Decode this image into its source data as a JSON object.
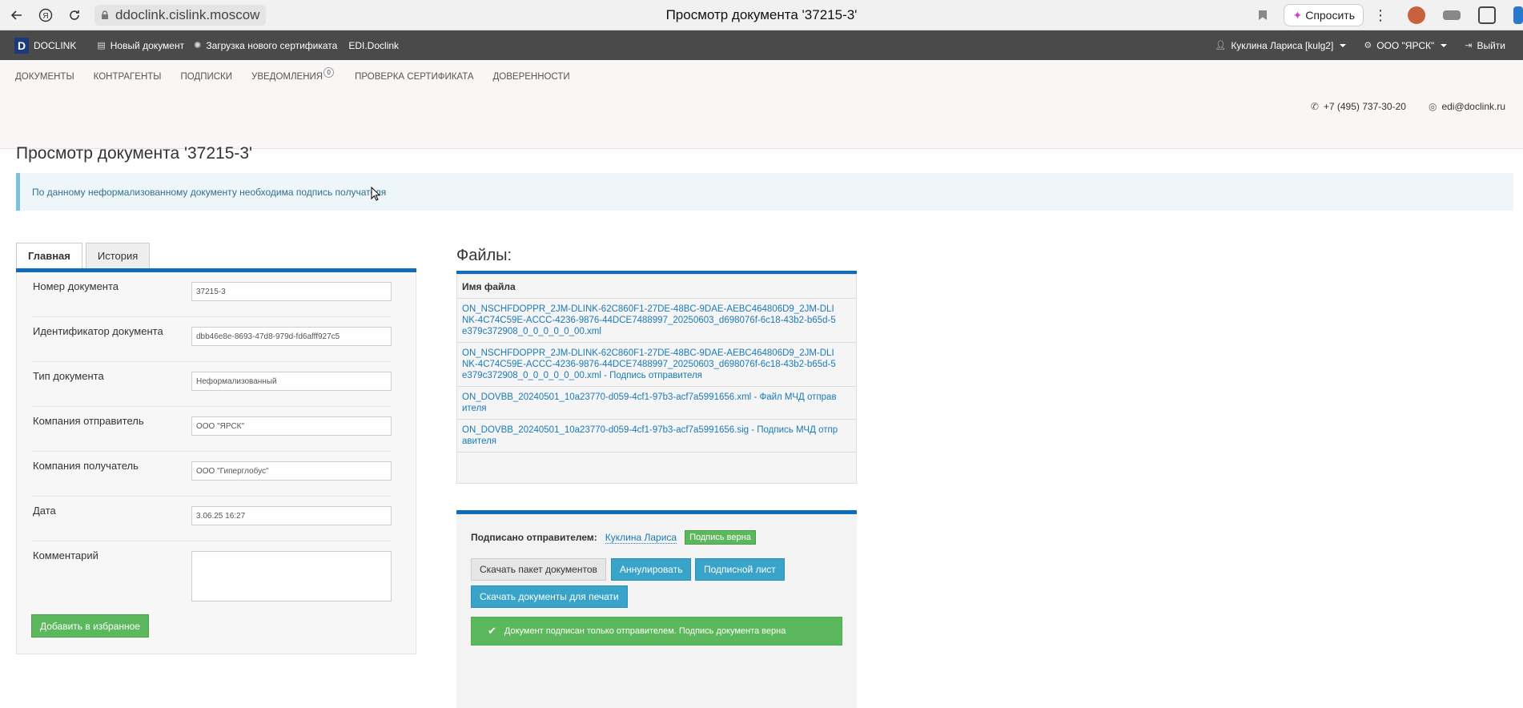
{
  "browser": {
    "url": "ddoclink.cislink.moscow",
    "tab_title": "Просмотр документа '37215-3'",
    "ask_label": "Спросить"
  },
  "navbar": {
    "brand_letter": "D",
    "brand": "DOCLINK",
    "new_doc": "Новый документ",
    "upload_cert": "Загрузка нового сертификата",
    "edi": "EDI.Doclink",
    "user": "Куклина Лариса [kulg2]",
    "org": "ООО \"ЯРСК\"",
    "logout": "Выйти"
  },
  "menu": {
    "items": [
      "ДОКУМЕНТЫ",
      "КОНТРАГЕНТЫ",
      "ПОДПИСКИ",
      "УВЕДОМЛЕНИЯ",
      "ПРОВЕРКА СЕРТИФИКАТА",
      "ДОВЕРЕННОСТИ"
    ],
    "notifications_count": "0",
    "phone": "+7 (495) 737-30-20",
    "email": "edi@doclink.ru"
  },
  "page": {
    "title": "Просмотр документа '37215-3'",
    "alert": "По данному неформализованному документу необходима подпись получателя"
  },
  "tabs": [
    "Главная",
    "История"
  ],
  "form": {
    "fields": [
      {
        "label": "Номер документа",
        "value": "37215-3"
      },
      {
        "label": "Идентификатор документа",
        "value": "dbb46e8e-8693-47d8-979d-fd6afff927c5"
      },
      {
        "label": "Тип документа",
        "value": "Неформализованный"
      },
      {
        "label": "Компания отправитель",
        "value": "ООО \"ЯРСК\""
      },
      {
        "label": "Компания получатель",
        "value": "ООО \"Гиперглобус\""
      },
      {
        "label": "Дата",
        "value": "3.06.25 16:27"
      }
    ],
    "comment_label": "Комментарий",
    "favorite_btn": "Добавить в избранное"
  },
  "files": {
    "title": "Файлы:",
    "header": "Имя файла",
    "rows": [
      "ON_NSCHFDOPPR_2JM-DLINK-62C860F1-27DE-48BC-9DAE-AEBC464806D9_2JM-DLINK-4C74C59E-ACCC-4236-9876-44DCE7488997_20250603_d698076f-6c18-43b2-b65d-5e379c372908_0_0_0_0_0_00.xml",
      "ON_NSCHFDOPPR_2JM-DLINK-62C860F1-27DE-48BC-9DAE-AEBC464806D9_2JM-DLINK-4C74C59E-ACCC-4236-9876-44DCE7488997_20250603_d698076f-6c18-43b2-b65d-5e379c372908_0_0_0_0_0_00.xml - Подпись отправителя",
      "ON_DOVBB_20240501_10a23770-d059-4cf1-97b3-acf7a5991656.xml - Файл МЧД отправителя",
      "ON_DOVBB_20240501_10a23770-d059-4cf1-97b3-acf7a5991656.sig - Подпись МЧД отправителя"
    ]
  },
  "signature": {
    "signed_by_label": "Подписано отправителем:",
    "signer": "Куклина Лариса",
    "valid_badge": "Подпись верна",
    "download_package": "Скачать пакет документов",
    "annul": "Аннулировать",
    "sign_sheet": "Подписной лист",
    "download_print": "Скачать документы для печати",
    "status": "Документ подписан только отправителем. Подпись документа верна"
  }
}
